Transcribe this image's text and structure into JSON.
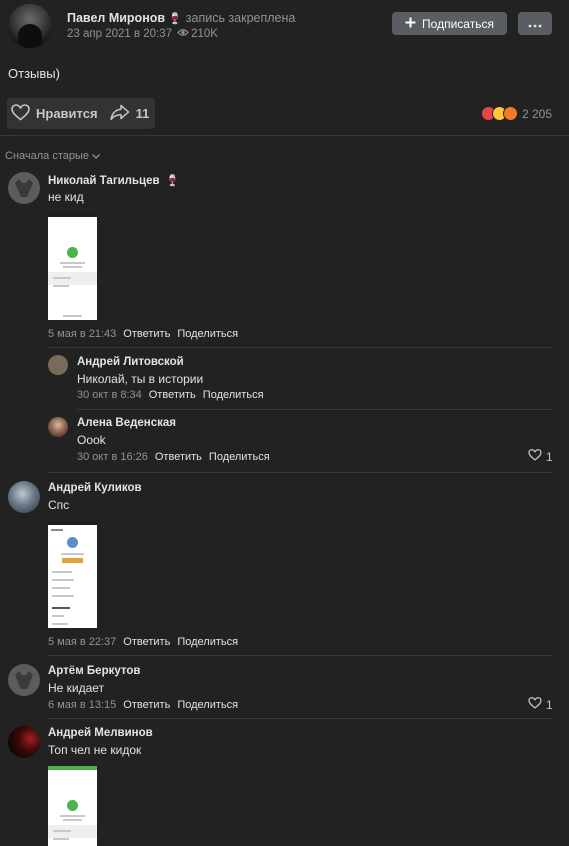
{
  "post": {
    "author": "Павел Миронов",
    "author_emoji": "🍷",
    "pinned_label": "запись закреплена",
    "date": "23 апр 2021 в 20:37",
    "views": "210K",
    "subscribe_label": "Подписаться",
    "text": "Отзывы)",
    "like_label": "Нравится",
    "share_count": "11",
    "reactions_count": "2 205"
  },
  "sort_label": "Сначала старые",
  "comments": [
    {
      "name": "Николай Тагильцев",
      "name_emoji": "🍷",
      "text": "не кид",
      "date": "5 мая в 21:43",
      "reply": "Ответить",
      "share": "Поделиться"
    },
    {
      "name": "Андрей Литовской",
      "text": "Николай, ты в истории",
      "date": "30 окт в 8:34",
      "reply": "Ответить",
      "share": "Поделиться"
    },
    {
      "name": "Алена Веденская",
      "text": "Oook",
      "date": "30 окт в 16:26",
      "reply": "Ответить",
      "share": "Поделиться",
      "likes": "1"
    },
    {
      "name": "Андрей Куликов",
      "text": "Спс",
      "date": "5 мая в 22:37",
      "reply": "Ответить",
      "share": "Поделиться"
    },
    {
      "name": "Артём Беркутов",
      "text": "Не кидает",
      "date": "6 мая в 13:15",
      "reply": "Ответить",
      "share": "Поделиться",
      "likes": "1"
    },
    {
      "name": "Андрей Мелвинов",
      "text": "Топ чел не кидок"
    }
  ],
  "colors": {
    "background": "#222222",
    "button": "#5a5d61",
    "secondary_text": "#8f9399",
    "success": "#4bb34b"
  },
  "icons": [
    "eye-icon",
    "plus-icon",
    "more-icon",
    "heart-icon",
    "share-icon",
    "chevron-down-icon"
  ]
}
